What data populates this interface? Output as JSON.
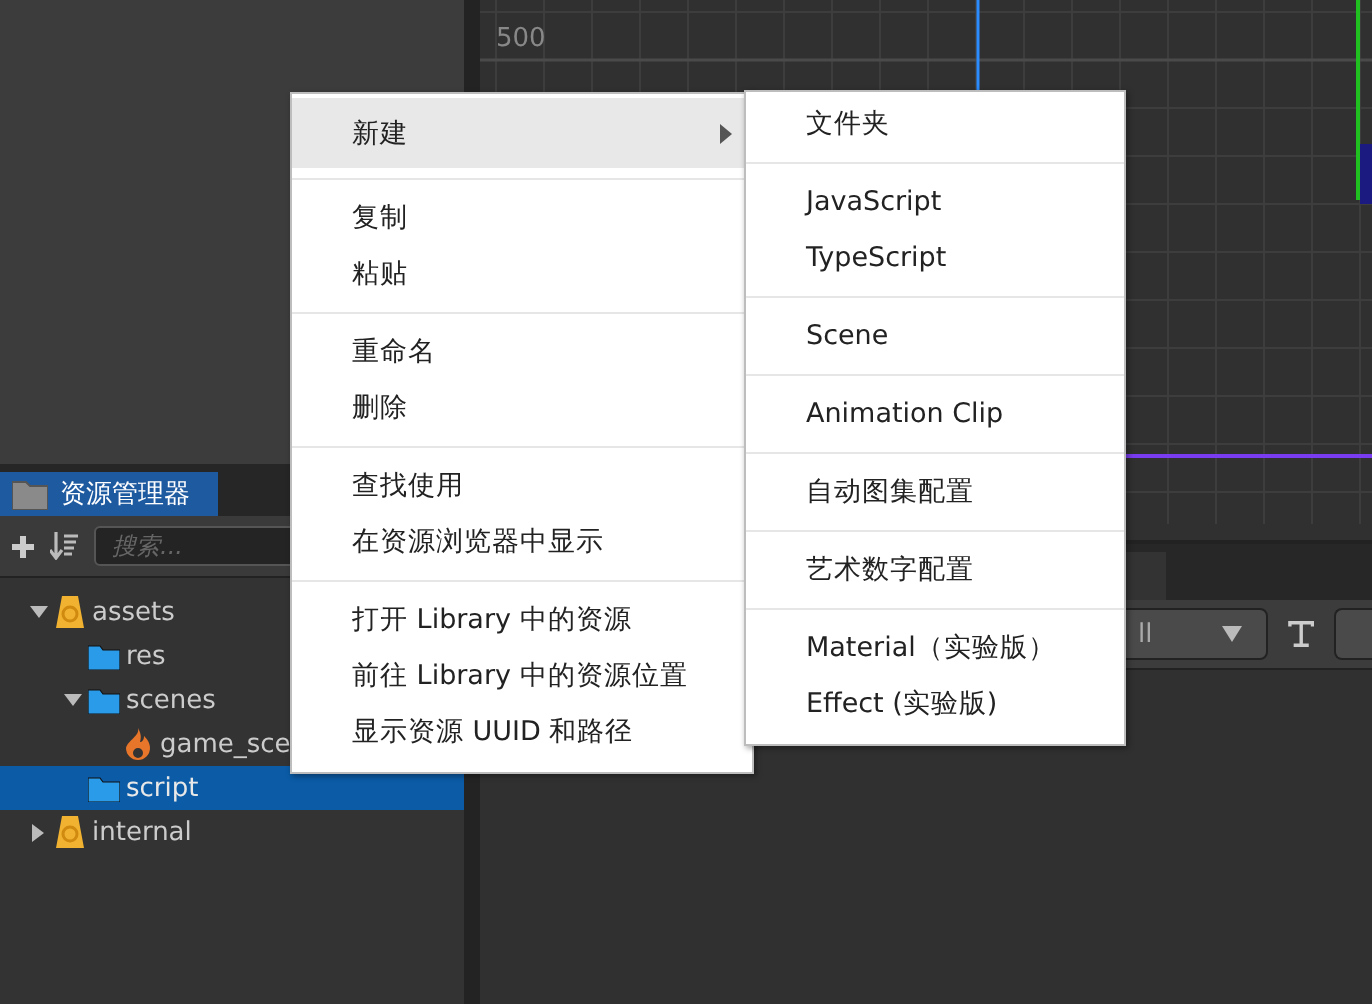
{
  "scene": {
    "ruler_label": "500"
  },
  "assets_panel": {
    "tab": "资源管理器",
    "search": {
      "placeholder": "搜索..."
    },
    "tree": [
      {
        "label": "assets",
        "kind": "root",
        "expanded": true,
        "selected": false,
        "children": [
          {
            "label": "res",
            "kind": "folder",
            "selected": false
          },
          {
            "label": "scenes",
            "kind": "folder",
            "expanded": true,
            "selected": false,
            "children": [
              {
                "label": "game_sce",
                "kind": "scene",
                "selected": false
              }
            ]
          },
          {
            "label": "script",
            "kind": "folder",
            "selected": true
          }
        ]
      },
      {
        "label": "internal",
        "kind": "root",
        "expanded": false,
        "selected": false
      }
    ]
  },
  "console": {
    "filter": "ll"
  },
  "context_menu": {
    "groups": [
      [
        {
          "label": "新建",
          "has_submenu": true,
          "highlighted": true
        }
      ],
      [
        {
          "label": "复制",
          "has_submenu": false,
          "highlighted": false
        },
        {
          "label": "粘贴",
          "has_submenu": false,
          "highlighted": false
        }
      ],
      [
        {
          "label": "重命名",
          "has_submenu": false,
          "highlighted": false
        },
        {
          "label": "删除",
          "has_submenu": false,
          "highlighted": false
        }
      ],
      [
        {
          "label": "查找使用",
          "has_submenu": false,
          "highlighted": false
        },
        {
          "label": "在资源浏览器中显示",
          "has_submenu": false,
          "highlighted": false
        }
      ],
      [
        {
          "label": "打开 Library 中的资源",
          "has_submenu": false,
          "highlighted": false
        },
        {
          "label": "前往 Library 中的资源位置",
          "has_submenu": false,
          "highlighted": false
        },
        {
          "label": "显示资源 UUID 和路径",
          "has_submenu": false,
          "highlighted": false
        }
      ]
    ]
  },
  "submenu": {
    "groups": [
      [
        {
          "label": "文件夹",
          "has_submenu": false,
          "highlighted": false
        }
      ],
      [
        {
          "label": "JavaScript",
          "has_submenu": false,
          "highlighted": false
        },
        {
          "label": "TypeScript",
          "has_submenu": false,
          "highlighted": false
        }
      ],
      [
        {
          "label": "Scene",
          "has_submenu": false,
          "highlighted": false
        }
      ],
      [
        {
          "label": "Animation Clip",
          "has_submenu": false,
          "highlighted": false
        }
      ],
      [
        {
          "label": "自动图集配置",
          "has_submenu": false,
          "highlighted": false
        }
      ],
      [
        {
          "label": "艺术数字配置",
          "has_submenu": false,
          "highlighted": false
        }
      ],
      [
        {
          "label": "Material（实验版）",
          "has_submenu": false,
          "highlighted": false
        },
        {
          "label": "Effect (实验版)",
          "has_submenu": false,
          "highlighted": false
        }
      ]
    ]
  }
}
